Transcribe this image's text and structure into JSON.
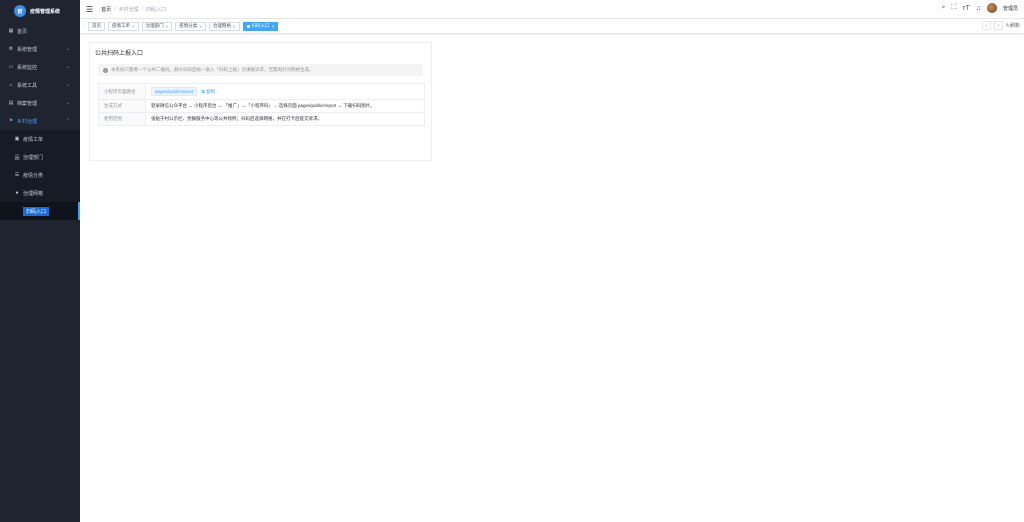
{
  "app": {
    "title": "疫情管理系统",
    "logo_glyph": "疫"
  },
  "sidebar": {
    "items": [
      {
        "label": "首页",
        "icon": "dashboard-icon"
      },
      {
        "label": "系统管理",
        "icon": "gear-icon"
      },
      {
        "label": "系统监控",
        "icon": "monitor-icon"
      },
      {
        "label": "系统工具",
        "icon": "tool-icon"
      },
      {
        "label": "档案管理",
        "icon": "archive-icon"
      },
      {
        "label": "乡村治理",
        "icon": "flag-icon"
      }
    ],
    "sub_items": [
      {
        "label": "疫情工单",
        "icon": "document-icon"
      },
      {
        "label": "治理部门",
        "icon": "tree-icon"
      },
      {
        "label": "疫情分类",
        "icon": "list-icon"
      },
      {
        "label": "治理网格",
        "icon": "person-icon"
      },
      {
        "label": "扫码入口",
        "icon": ""
      }
    ]
  },
  "navbar": {
    "breadcrumb": [
      "首页",
      "乡村治理",
      "扫码入口"
    ],
    "user_name": "管理员"
  },
  "tags": [
    "首页",
    "疫情工单",
    "治理部门",
    "疫情分类",
    "治理网格",
    "扫码入口"
  ],
  "tags_refresh": "刷新",
  "card": {
    "title": "公共扫码上报入口",
    "alert": "本系统只需要一个公共二维码，群众扫码后统一进入「扫码上报」页填报诉求，无需再针对网格生成。",
    "rows": [
      {
        "label": "小程序页面路径",
        "value": "pages/public/report",
        "copy": "复制"
      },
      {
        "label": "生成方式",
        "value": "登录微信公众平台 → 小程序后台 → 「推广」→「小程序码」→ 选择页面 pages/public/report → 下载扫码图片。"
      },
      {
        "label": "使用范围",
        "value": "张贴于村公示栏、党群服务中心等公共场所；扫码后选择网格，并在打卡后提交诉求。"
      }
    ]
  },
  "colors": {
    "accent": "#409eff",
    "sidebar_bg": "#1f2430",
    "active_tag": "#42a5f5"
  }
}
